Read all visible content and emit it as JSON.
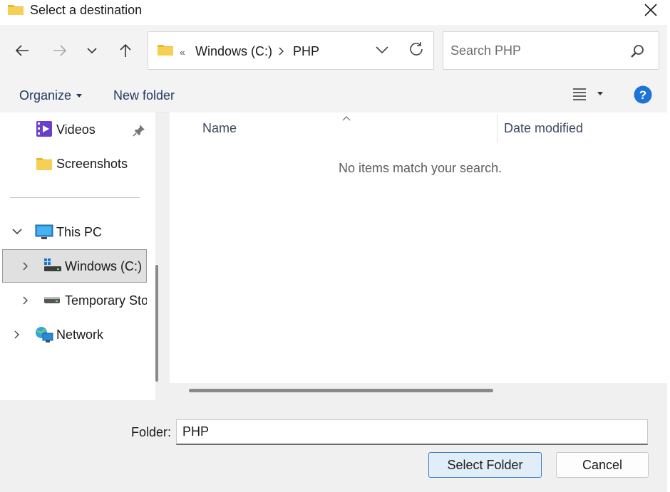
{
  "window": {
    "title": "Select a destination"
  },
  "nav": {
    "address": {
      "overflow": "«",
      "segments": [
        "Windows (C:)",
        "PHP"
      ]
    },
    "search": {
      "placeholder": "Search PHP"
    }
  },
  "toolbar": {
    "organize_label": "Organize",
    "new_folder_label": "New folder"
  },
  "sidebar": {
    "quick_access": [
      {
        "label": "Videos",
        "icon": "videos-folder-icon",
        "pinned": true
      },
      {
        "label": "Screenshots",
        "icon": "folder-icon",
        "pinned": false
      }
    ],
    "this_pc": {
      "label": "This PC",
      "expanded": true
    },
    "drives": [
      {
        "label": "Windows (C:)",
        "selected": true
      },
      {
        "label": "Temporary Sto"
      }
    ],
    "network": {
      "label": "Network"
    }
  },
  "file_list": {
    "columns": [
      "Name",
      "Date modified"
    ],
    "empty_message": "No items match your search."
  },
  "footer": {
    "folder_label": "Folder:",
    "folder_value": "PHP",
    "primary_button": "Select Folder",
    "cancel_button": "Cancel"
  },
  "colors": {
    "accent": "#3b7fc4",
    "help": "#1e74d4",
    "folder": "#f3c646"
  }
}
